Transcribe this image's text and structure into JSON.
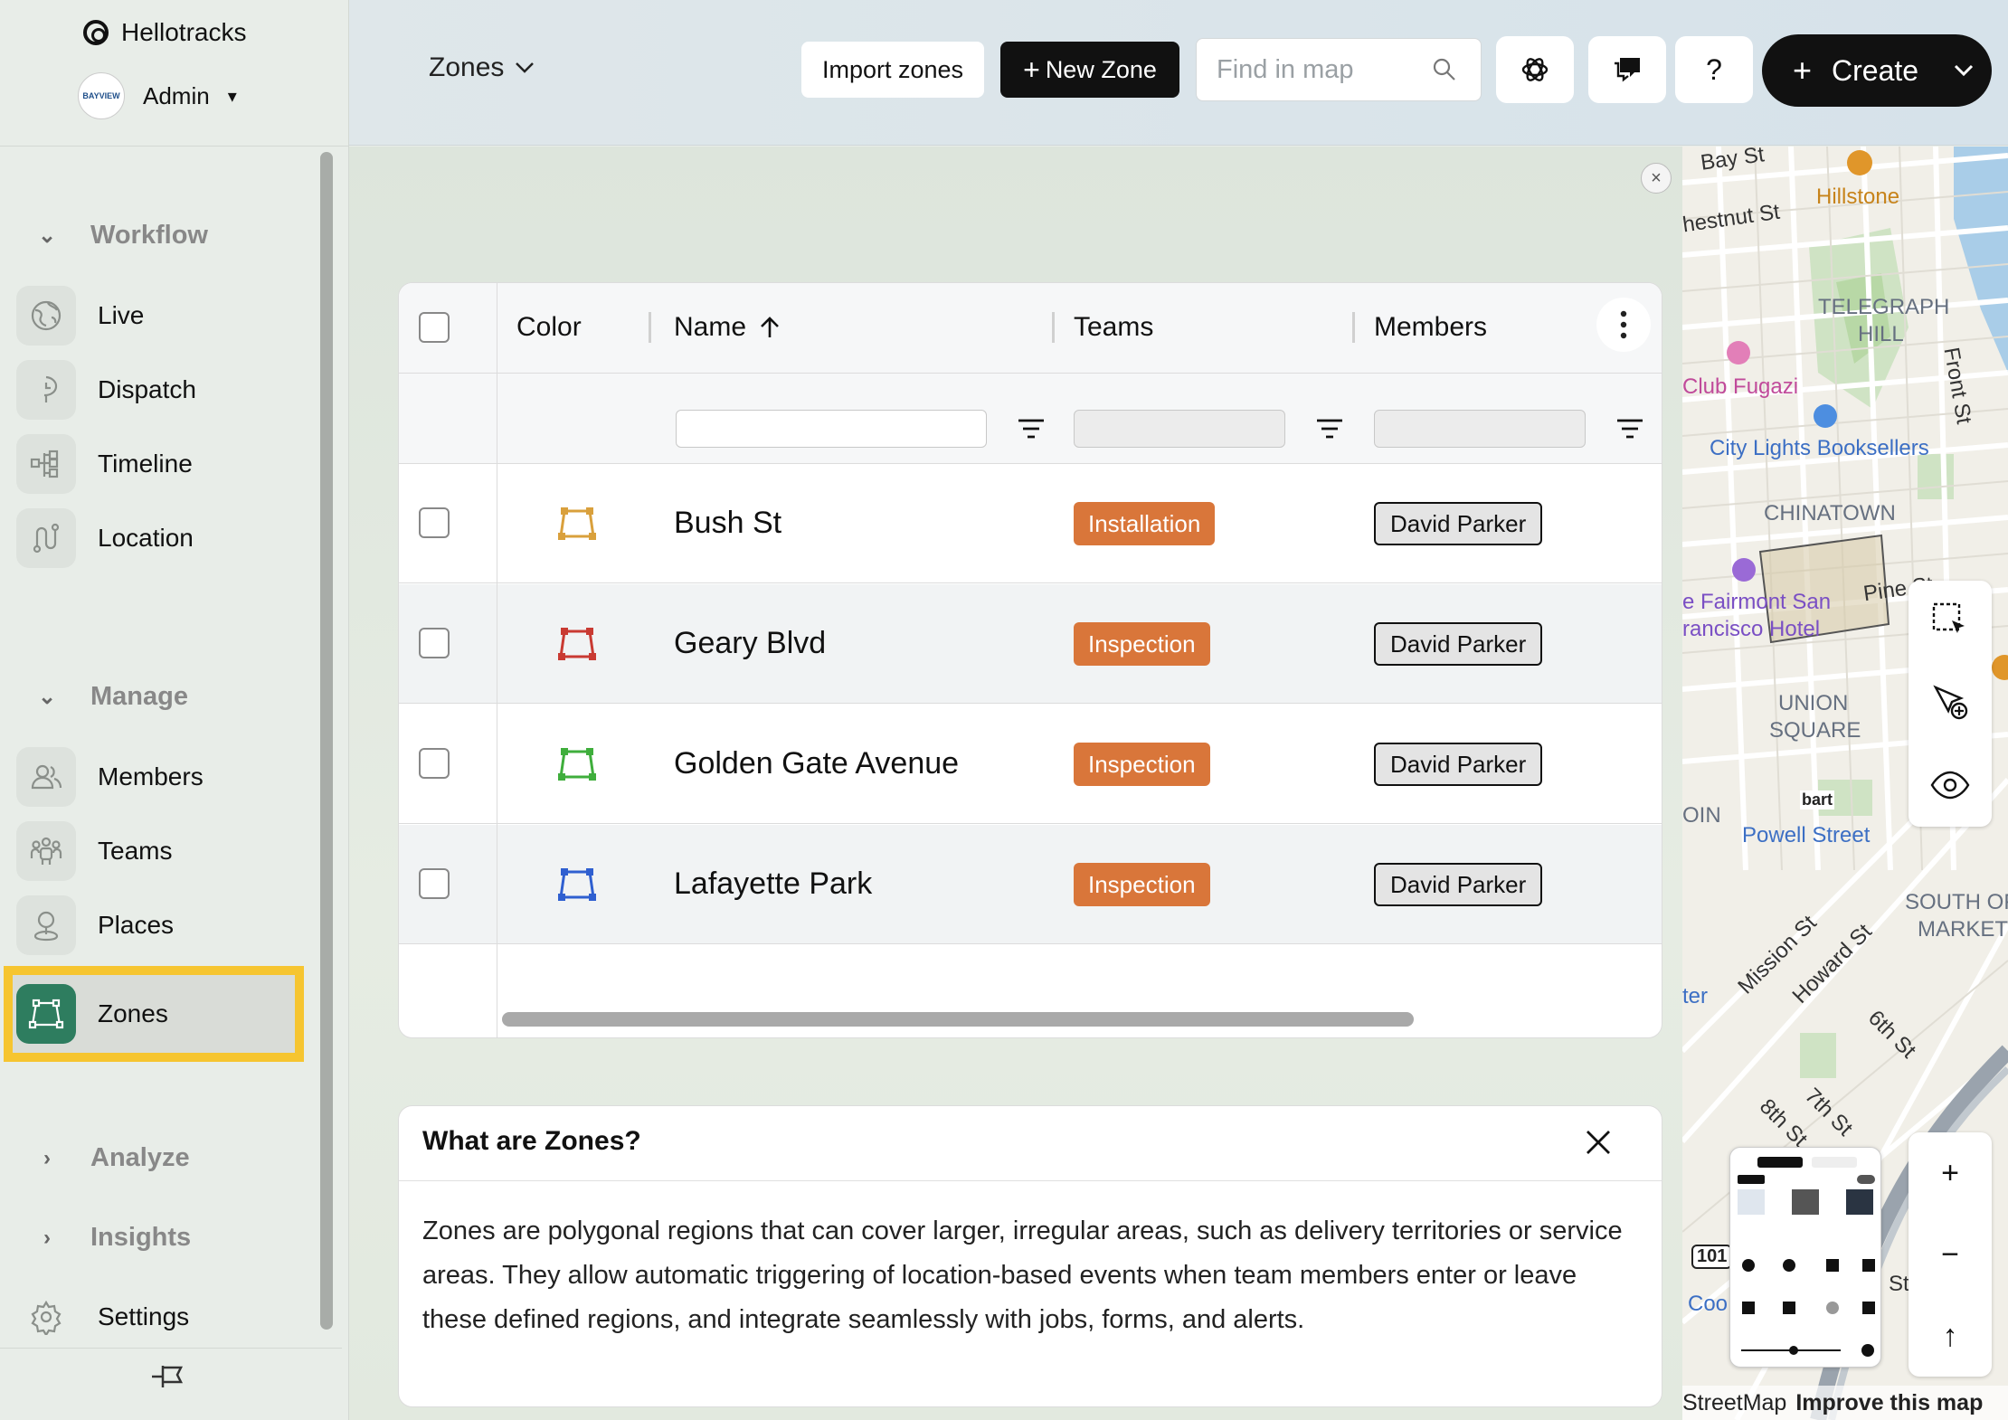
{
  "app": {
    "brand": "Hellotracks",
    "account": "Admin",
    "avatar_text": "BAYVIEW"
  },
  "sidebar": {
    "sections": [
      {
        "label": "Workflow",
        "expanded": true
      },
      {
        "label": "Manage",
        "expanded": true
      },
      {
        "label": "Analyze",
        "expanded": false
      },
      {
        "label": "Insights",
        "expanded": false
      }
    ],
    "workflow_items": [
      {
        "label": "Live",
        "icon": "globe-icon"
      },
      {
        "label": "Dispatch",
        "icon": "dispatch-icon"
      },
      {
        "label": "Timeline",
        "icon": "timeline-icon"
      },
      {
        "label": "Location",
        "icon": "route-icon"
      }
    ],
    "manage_items": [
      {
        "label": "Members",
        "icon": "members-icon"
      },
      {
        "label": "Teams",
        "icon": "teams-icon"
      },
      {
        "label": "Places",
        "icon": "place-pin-icon"
      },
      {
        "label": "Zones",
        "icon": "zone-polygon-icon",
        "active": true
      }
    ],
    "settings_label": "Settings"
  },
  "header": {
    "view_selector": "Zones",
    "import_label": "Import zones",
    "new_zone_label": "New Zone",
    "search_placeholder": "Find in map",
    "help_label": "?",
    "create_label": "Create"
  },
  "table": {
    "columns": [
      "Color",
      "Name",
      "Teams",
      "Members"
    ],
    "sort": {
      "column": "Name",
      "direction": "ascending"
    },
    "rows": [
      {
        "name": "Bush St",
        "color": "#d9a03c",
        "team": "Installation",
        "member": "David Parker"
      },
      {
        "name": "Geary Blvd",
        "color": "#c93a32",
        "team": "Inspection",
        "member": "David Parker"
      },
      {
        "name": "Golden Gate Avenue",
        "color": "#3fae3c",
        "team": "Inspection",
        "member": "David Parker"
      },
      {
        "name": "Lafayette Park",
        "color": "#2f5fd0",
        "team": "Inspection",
        "member": "David Parker"
      }
    ]
  },
  "info": {
    "title": "What are Zones?",
    "body": "Zones are polygonal regions that can cover larger, irregular areas, such as delivery territories or service areas. They allow automatic triggering of location-based events when team members enter or leave these defined regions, and integrate seamlessly with jobs, forms, and alerts."
  },
  "map": {
    "labels": {
      "bay_st": "Bay St",
      "hillstone": "Hillstone",
      "chestnut": "hestnut St",
      "telegraph": "TELEGRAPH",
      "hill": "HILL",
      "club_fugazi": "Club Fugazi",
      "front_st": "Front St",
      "city_lights": "City Lights Booksellers",
      "chinatown": "CHINATOWN",
      "pine_st": "Pine St",
      "fairmont1": "e Fairmont San",
      "fairmont2": "rancisco Hotel",
      "union": "UNION",
      "square": "SQUARE",
      "oin": "OIN",
      "powell": "Powell Street",
      "south_of": "SOUTH OF",
      "market": "MARKET",
      "mission": "Mission St",
      "howard": "Howard St",
      "sixth": "6th St",
      "seventh": "7th St",
      "eighth": "8th St",
      "ter": "ter",
      "hwy": "101",
      "coo": "Coo",
      "st": "St",
      "bart": "bart"
    },
    "footer_left": "StreetMap",
    "footer_right": "Improve this map",
    "zoom_in": "+",
    "zoom_out": "−",
    "north": "↑"
  },
  "colors": {
    "accent": "#2e7d5f",
    "highlight": "#f6c530",
    "badge": "#d9763a"
  }
}
